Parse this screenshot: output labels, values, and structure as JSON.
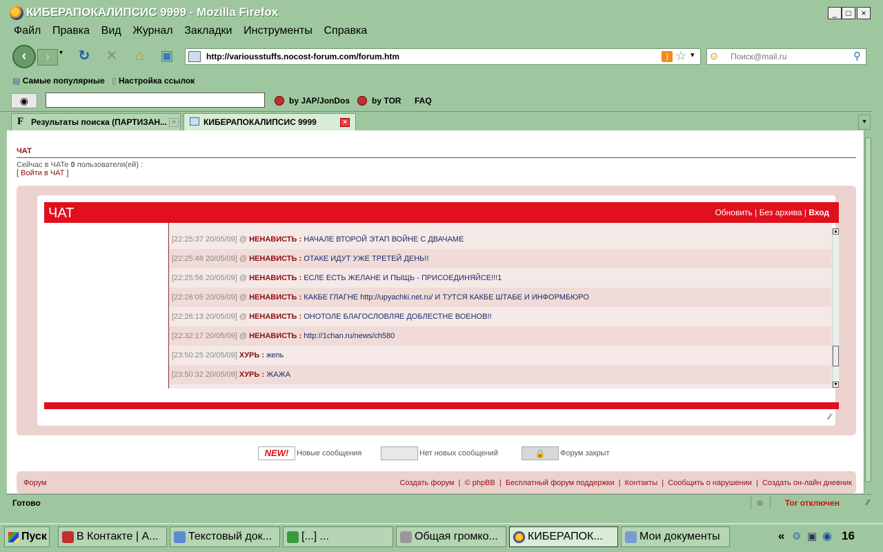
{
  "window": {
    "title": "КИБЕРАПОКАЛИПСИС 9999 - Mozilla Firefox",
    "controls": [
      "_",
      "□",
      "×"
    ]
  },
  "menu": {
    "items": [
      {
        "label": "Файл"
      },
      {
        "label": "Правка"
      },
      {
        "label": "Вид"
      },
      {
        "label": "Журнал"
      },
      {
        "label": "Закладки"
      },
      {
        "label": "Инструменты"
      },
      {
        "label": "Справка"
      }
    ]
  },
  "nav": {
    "url": "http://variousstuffs.nocost-forum.com/forum.htm",
    "search_placeholder": "Поиск@mail.ru"
  },
  "bookmarks": {
    "popular": "Самые популярные",
    "settings": "Настройка ссылок"
  },
  "anon": {
    "jap": "by JAP/JonDos",
    "tor": "by TOR",
    "faq": "FAQ"
  },
  "tabs": [
    {
      "label": "Результаты поиска (ПАРТИЗАН..."
    },
    {
      "label": "КИБЕРАПОКАЛИПСИС 9999"
    }
  ],
  "page": {
    "chat_heading": "ЧАТ",
    "chat_info_prefix": "Сейчас в ЧАТе",
    "chat_info_count": "0",
    "chat_info_suffix": "пользователя(ей) :",
    "enter_chat": "[ Войти в ЧАТ ]",
    "chat_box": {
      "title": "ЧАТ",
      "refresh": "Обновить",
      "no_archive": "Без архива",
      "login": "Вход",
      "messages": [
        {
          "ts": "[22:25:37 20/05/09]",
          "at": "@",
          "nick": "НЕНАВИСТЬ :",
          "text": "НАЧАЛЕ ВТОРОЙ ЭТАП ВОЙНЕ С ДВАЧАМЕ"
        },
        {
          "ts": "[22:25:48 20/05/09]",
          "at": "@",
          "nick": "НЕНАВИСТЬ :",
          "text": "ОТАКЕ ИДУТ УЖЕ ТРЕТЕЙ ДЕНЬ!!"
        },
        {
          "ts": "[22:25:56 20/05/09]",
          "at": "@",
          "nick": "НЕНАВИСТЬ :",
          "text": "ЕСЛЕ ЕСТЬ ЖЕЛАНЕ И ПЫЩЬ - ПРИСОЕДИНЯЙСЕ!!!1"
        },
        {
          "ts": "[22:26:05 20/05/09]",
          "at": "@",
          "nick": "НЕНАВИСТЬ :",
          "text": "КАКБЕ ГЛАГНЕ http://upyachki.net.ru/ И ТУТСЯ КАКБЕ ШТАБЕ И ИНФОРМБЮРО"
        },
        {
          "ts": "[22:26:13 20/05/09]",
          "at": "@",
          "nick": "НЕНАВИСТЬ :",
          "text": "ОНОТОЛЕ БЛАГОСЛОВЛЯЕ ДОБЛЕСТНЕ ВОЕНОВ!!"
        },
        {
          "ts": "[22:32:17 20/05/09]",
          "at": "@",
          "nick": "НЕНАВИСТЬ :",
          "text": "http://1chan.ru/news/ch580"
        },
        {
          "ts": "[23:50:25 20/05/09]",
          "at": "",
          "nick": "ХУРЬ :",
          "text": "жепь"
        },
        {
          "ts": "[23:50:32 20/05/09]",
          "at": "",
          "nick": "ХУРЬ :",
          "text": "ЖАЖА"
        }
      ]
    },
    "legend": {
      "new_badge": "NEW!",
      "new": "Новые сообщения",
      "no_new": "Нет новых сообщений",
      "closed": "Форум закрыт"
    },
    "footer": {
      "forum": "Форум",
      "create_forum": "Создать форум",
      "copyright": "©",
      "phpbb": "phpBB",
      "free_support": "Бесплатный форум поддержки",
      "contacts": "Контакты",
      "report": "Сообщить о нарушении",
      "diary": "Создать он-лайн дневник"
    }
  },
  "status": {
    "text": "Готово",
    "tor": "Tor отключен"
  },
  "taskbar": {
    "start": "Пуск",
    "items": [
      {
        "label": "В Контакте | А..."
      },
      {
        "label": "Текстовый док..."
      },
      {
        "label": "[...] ..."
      },
      {
        "label": "Общая громко..."
      },
      {
        "label": "КИБЕРАПОК..."
      },
      {
        "label": "Мои документы"
      }
    ],
    "tray_arrow": "«",
    "clock": "16"
  },
  "colors": {
    "chrome": "#9fc79f",
    "forum_red": "#e0101e",
    "nick": "#8a1010",
    "panel": "#ecd2cf"
  }
}
